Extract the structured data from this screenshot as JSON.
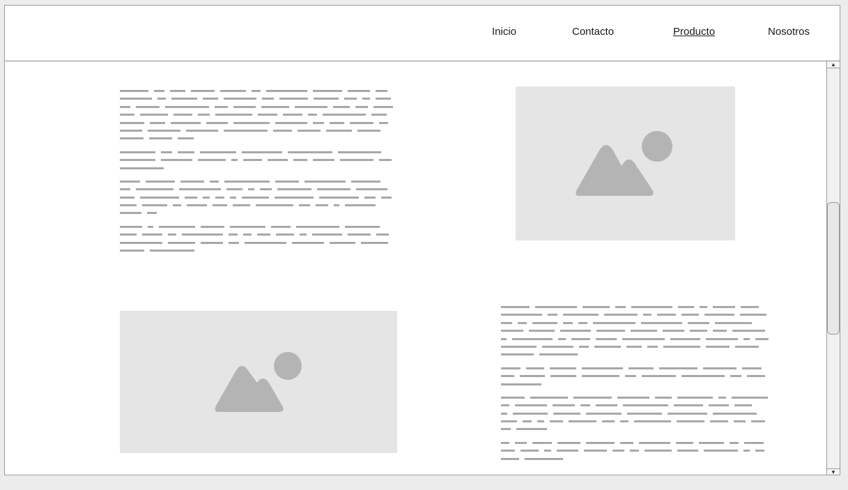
{
  "nav": {
    "items": [
      {
        "label": "Inicio",
        "active": false
      },
      {
        "label": "Contacto",
        "active": false
      },
      {
        "label": "Producto",
        "active": true
      },
      {
        "label": "Nosotros",
        "active": false
      }
    ]
  },
  "sections": [
    {
      "type": "text-block",
      "placeholder_color": "#a8a8a8"
    },
    {
      "type": "image-placeholder",
      "icon": "image-icon",
      "fill": "#e5e5e5",
      "icon_color": "#b4b4b4"
    },
    {
      "type": "image-placeholder",
      "icon": "image-icon",
      "fill": "#e5e5e5",
      "icon_color": "#b4b4b4"
    },
    {
      "type": "text-block",
      "placeholder_color": "#a8a8a8"
    }
  ],
  "scrollbar": {
    "up_icon": "arrow-up-icon",
    "down_icon": "arrow-down-icon",
    "scroll_position": 0.4
  }
}
